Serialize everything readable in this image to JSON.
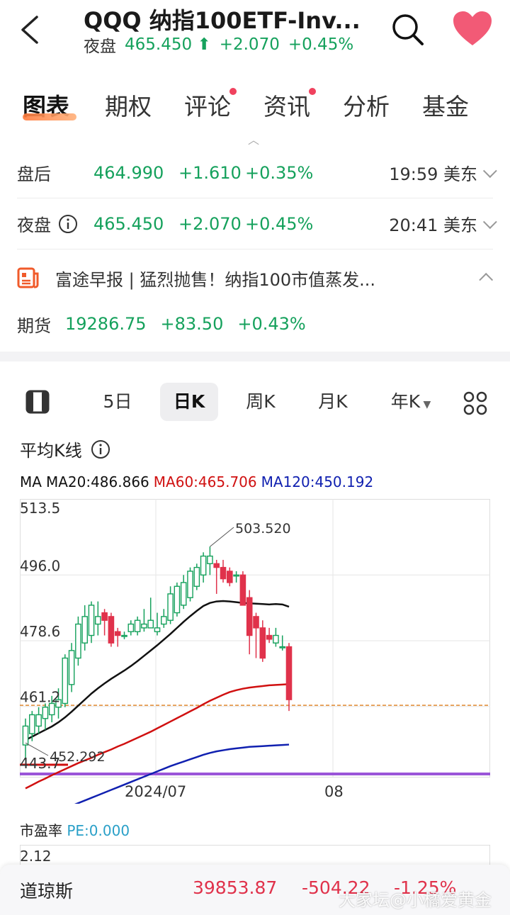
{
  "header": {
    "title": "QQQ  纳指100ETF-Inv...",
    "session_label": "夜盘",
    "price": "465.450",
    "change": "+2.070",
    "change_pct": "+0.45%"
  },
  "tabs": [
    {
      "label": "图表",
      "active": true
    },
    {
      "label": "期权"
    },
    {
      "label": "评论",
      "badge": true
    },
    {
      "label": "资讯",
      "badge": true
    },
    {
      "label": "分析"
    },
    {
      "label": "基金"
    }
  ],
  "quotes": {
    "after_hours": {
      "label": "盘后",
      "price": "464.990",
      "change": "+1.610",
      "pct": "+0.35%",
      "time": "19:59 美东"
    },
    "overnight": {
      "label": "夜盘",
      "price": "465.450",
      "change": "+2.070",
      "pct": "+0.45%",
      "time": "20:41 美东"
    }
  },
  "news": {
    "text": "富途早报 | 猛烈抛售！纳指100市值蒸发..."
  },
  "futures": {
    "label": "期货",
    "price": "19286.75",
    "change": "+83.50",
    "pct": "+0.43%"
  },
  "periods": [
    "5日",
    "日K",
    "周K",
    "月K",
    "年K"
  ],
  "ma_section": {
    "title": "平均K线",
    "prefix": "MA",
    "ma20": "MA20:486.866",
    "ma60": "MA60:465.706",
    "ma120": "MA120:450.192"
  },
  "chart_data": {
    "type": "candlestick",
    "y_ticks": [
      "513.5",
      "496.0",
      "478.6",
      "461.2",
      "443.7"
    ],
    "x_ticks": [
      "2024/07",
      "08"
    ],
    "annotations": {
      "high": "503.520",
      "low": "452.292"
    },
    "ylim": [
      443.7,
      513.5
    ],
    "reference_line": 461.5,
    "candles": [
      {
        "o": 451,
        "h": 458,
        "l": 447,
        "c": 456
      },
      {
        "o": 454,
        "h": 460,
        "l": 452,
        "c": 459
      },
      {
        "o": 456,
        "h": 461,
        "l": 454,
        "c": 459
      },
      {
        "o": 458,
        "h": 462,
        "l": 455,
        "c": 461
      },
      {
        "o": 459,
        "h": 464,
        "l": 457,
        "c": 462
      },
      {
        "o": 461,
        "h": 466,
        "l": 458,
        "c": 463
      },
      {
        "o": 462,
        "h": 475,
        "l": 461,
        "c": 474
      },
      {
        "o": 467,
        "h": 478,
        "l": 465,
        "c": 476
      },
      {
        "o": 474,
        "h": 485,
        "l": 472,
        "c": 483
      },
      {
        "o": 478,
        "h": 488,
        "l": 476,
        "c": 485
      },
      {
        "o": 480,
        "h": 489,
        "l": 478,
        "c": 488
      },
      {
        "o": 483,
        "h": 489,
        "l": 480,
        "c": 485
      },
      {
        "o": 486,
        "h": 487,
        "l": 480,
        "c": 484
      },
      {
        "o": 485,
        "h": 486,
        "l": 477,
        "c": 478
      },
      {
        "o": 481,
        "h": 482,
        "l": 477,
        "c": 480
      },
      {
        "o": 480,
        "h": 481,
        "l": 479,
        "c": 480
      },
      {
        "o": 481,
        "h": 484,
        "l": 480,
        "c": 483
      },
      {
        "o": 481,
        "h": 485,
        "l": 480,
        "c": 484
      },
      {
        "o": 482,
        "h": 487,
        "l": 481,
        "c": 483
      },
      {
        "o": 482,
        "h": 490,
        "l": 482,
        "c": 484
      },
      {
        "o": 481,
        "h": 486,
        "l": 480,
        "c": 482
      },
      {
        "o": 483,
        "h": 487,
        "l": 482,
        "c": 485
      },
      {
        "o": 484,
        "h": 493,
        "l": 483,
        "c": 491
      },
      {
        "o": 486,
        "h": 494,
        "l": 485,
        "c": 493
      },
      {
        "o": 488,
        "h": 496,
        "l": 487,
        "c": 494
      },
      {
        "o": 490,
        "h": 498,
        "l": 489,
        "c": 497
      },
      {
        "o": 493,
        "h": 499,
        "l": 492,
        "c": 498
      },
      {
        "o": 496,
        "h": 502,
        "l": 494,
        "c": 501
      },
      {
        "o": 499,
        "h": 503.5,
        "l": 496,
        "c": 501
      },
      {
        "o": 499,
        "h": 500,
        "l": 491,
        "c": 498
      },
      {
        "o": 498,
        "h": 500,
        "l": 494,
        "c": 495
      },
      {
        "o": 497,
        "h": 498,
        "l": 493,
        "c": 494
      },
      {
        "o": 496,
        "h": 497,
        "l": 494,
        "c": 496
      },
      {
        "o": 496,
        "h": 497,
        "l": 488,
        "c": 488
      },
      {
        "o": 490,
        "h": 492,
        "l": 475,
        "c": 480
      },
      {
        "o": 485,
        "h": 486,
        "l": 474,
        "c": 482
      },
      {
        "o": 482,
        "h": 484,
        "l": 473,
        "c": 474
      },
      {
        "o": 480,
        "h": 482,
        "l": 478,
        "c": 479
      },
      {
        "o": 478,
        "h": 482,
        "l": 477,
        "c": 480
      },
      {
        "o": 477,
        "h": 480,
        "l": 476,
        "c": 477
      },
      {
        "o": 477,
        "h": 478,
        "l": 460,
        "c": 463
      }
    ],
    "ma20_series": [
      452.3,
      453.2,
      454.1,
      455.0,
      455.9,
      457.0,
      458.3,
      459.8,
      461.4,
      463.0,
      464.6,
      466.0,
      467.3,
      468.5,
      469.6,
      470.7,
      471.9,
      473.2,
      474.6,
      476.0,
      477.4,
      478.9,
      480.4,
      482.0,
      483.6,
      485.1,
      486.5,
      487.8,
      488.6,
      489.0,
      489.1,
      489.0,
      488.8,
      488.6,
      488.5,
      488.4,
      488.3,
      488.2,
      488.3,
      488.2,
      487.6
    ],
    "ma60_series": [
      439.5,
      440.4,
      441.3,
      442.1,
      443.0,
      443.8,
      444.6,
      445.4,
      446.2,
      446.9,
      447.6,
      448.4,
      449.1,
      449.8,
      450.6,
      451.3,
      452.1,
      452.9,
      453.7,
      454.5,
      455.4,
      456.3,
      457.2,
      458.1,
      459.0,
      459.9,
      460.8,
      461.8,
      462.7,
      463.5,
      464.3,
      465.0,
      465.5,
      465.9,
      466.2,
      466.4,
      466.6,
      466.8,
      466.9,
      467.0,
      467.1
    ],
    "ma120_series": [
      430.0,
      430.7,
      431.4,
      432.1,
      432.8,
      433.5,
      434.2,
      434.9,
      435.6,
      436.3,
      437.0,
      437.7,
      438.4,
      439.1,
      439.8,
      440.5,
      441.2,
      441.9,
      442.6,
      443.3,
      444.0,
      444.7,
      445.4,
      446.0,
      446.6,
      447.2,
      447.8,
      448.4,
      448.9,
      449.3,
      449.6,
      449.9,
      450.1,
      450.3,
      450.5,
      450.6,
      450.7,
      450.8,
      450.9,
      451.0,
      451.1
    ]
  },
  "pe": {
    "label": "市盈率",
    "value": "PE:0.000",
    "tick": "2.12"
  },
  "bottom_bar": {
    "name": "道琼斯",
    "price": "39853.87",
    "change": "-504.22",
    "pct": "-1.25%"
  },
  "watermark": "大家坛@小橘爱黄金",
  "colors": {
    "up": "#15a15c",
    "down": "#e0324b",
    "ma20": "#111111",
    "ma60": "#d01010",
    "ma120": "#1020b0",
    "ref": "#e08a30",
    "purple": "#9a55d8"
  }
}
